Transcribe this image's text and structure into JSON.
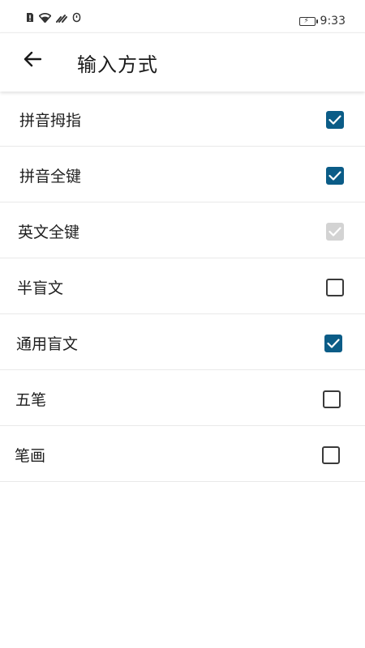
{
  "status_bar": {
    "time": "9:33",
    "icons": [
      "sim-alert-icon",
      "wifi-icon",
      "signal-icon",
      "notification-icon"
    ],
    "battery_state": "charging"
  },
  "header": {
    "back_icon": "arrow-left-icon",
    "title": "输入方式"
  },
  "colors": {
    "checkbox_checked": "#0b5c87",
    "checkbox_disabled": "#d3d3d3",
    "checkbox_border": "#3a3a3a"
  },
  "options": [
    {
      "label": "拼音拇指",
      "state": "checked"
    },
    {
      "label": "拼音全键",
      "state": "checked"
    },
    {
      "label": "英文全键",
      "state": "checked-disabled"
    },
    {
      "label": "半盲文",
      "state": "unchecked"
    },
    {
      "label": "通用盲文",
      "state": "checked"
    },
    {
      "label": "五笔",
      "state": "unchecked"
    },
    {
      "label": "笔画",
      "state": "unchecked"
    }
  ]
}
